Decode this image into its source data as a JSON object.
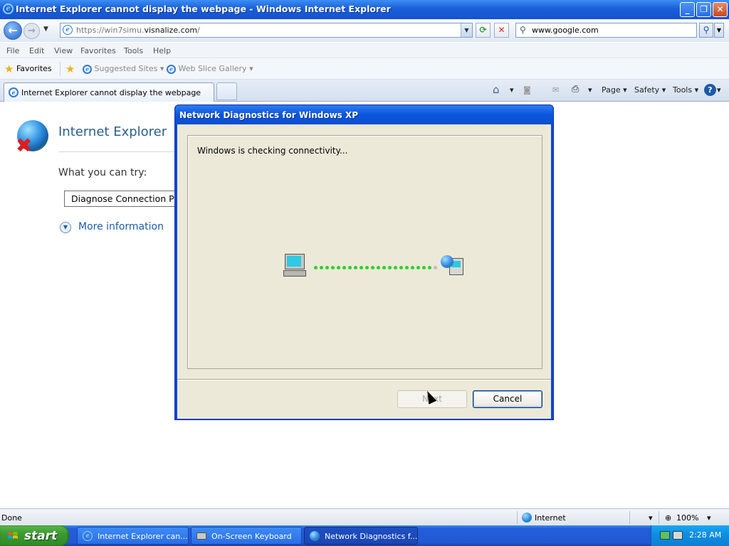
{
  "window": {
    "title": "Internet Explorer cannot display the webpage - Windows Internet Explorer",
    "minimize_glyph": "_",
    "restore_glyph": "❐",
    "close_glyph": "✕"
  },
  "nav": {
    "back_glyph": "←",
    "forward_glyph": "→",
    "dropdown_glyph": "▼",
    "url_prefix": "https://win7simu.",
    "url_domain": "visnalize.com",
    "url_suffix": "/",
    "refresh_glyph": "⟳",
    "stop_glyph": "✕",
    "search_value": "www.google.com",
    "search_glyph": "⚲"
  },
  "menu": {
    "items": [
      "File",
      "Edit",
      "View",
      "Favorites",
      "Tools",
      "Help"
    ]
  },
  "favorites_bar": {
    "favorites_label": "Favorites",
    "suggested_sites": "Suggested Sites",
    "web_slice_gallery": "Web Slice Gallery",
    "dropdown_glyph": "▾"
  },
  "tabs": {
    "active_label": "Internet Explorer cannot display the webpage"
  },
  "command_bar": {
    "home_glyph": "⌂",
    "feeds_glyph": "◙",
    "mail_glyph": "✉",
    "print_glyph": "⎙",
    "page_label": "Page",
    "safety_label": "Safety",
    "tools_label": "Tools",
    "help_glyph": "?",
    "dropdown_glyph": "▾"
  },
  "page": {
    "heading": "Internet Explorer",
    "what_you_can_try": "What you can try:",
    "diagnose_button": "Diagnose Connection Problems",
    "more_information": "More information",
    "error_glyph": "✖",
    "expand_glyph": "▼"
  },
  "dialog": {
    "title": "Network Diagnostics for Windows XP",
    "status_text": "Windows is checking connectivity...",
    "next_label": "Next",
    "cancel_label": "Cancel",
    "progress_dots_total": 22,
    "progress_dots_done": 21
  },
  "statusbar": {
    "status": "Done",
    "zone": "Internet",
    "zoom": "100%",
    "zoom_glyph": "⊕",
    "dropdown_glyph": "▾"
  },
  "taskbar": {
    "start_label": "start",
    "tasks": [
      {
        "label": "Internet Explorer can..."
      },
      {
        "label": "On-Screen Keyboard"
      },
      {
        "label": "Network Diagnostics f..."
      }
    ],
    "clock": "2:28 AM"
  },
  "colors": {
    "xp_blue": "#0a48d6",
    "progress_green": "#2bd12b",
    "link_blue": "#1d5ca8"
  }
}
